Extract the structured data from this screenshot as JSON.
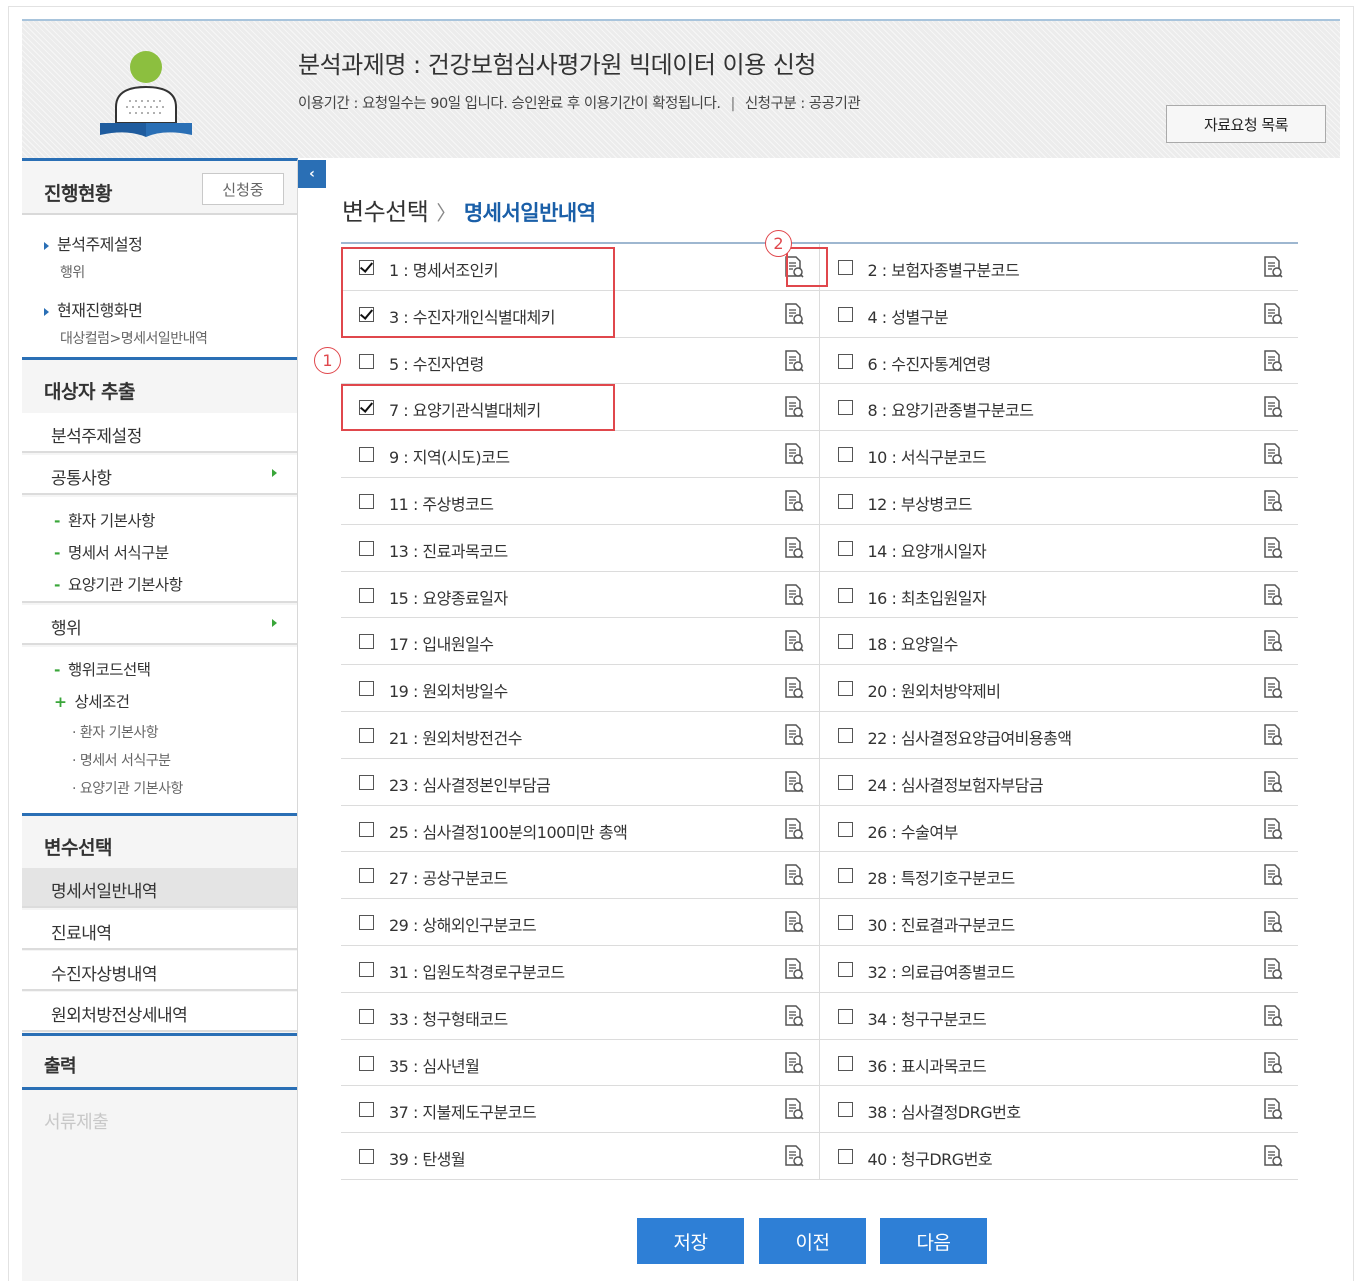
{
  "header": {
    "title": "분석과제명 : 건강보험심사평가원 빅데이터 이용 신청",
    "period_text": "이용기간 : 요청일수는 90일 입니다. 승인완료 후 이용기간이 확정됩니다.",
    "separator": "|",
    "apply_type": "신청구분 : 공공기관",
    "request_list_button": "자료요청 목록"
  },
  "sidebar": {
    "progress_title": "진행현황",
    "status_badge": "신청중",
    "progress_items": [
      {
        "label": "분석주제설정",
        "sub": "행위"
      },
      {
        "label": "현재진행화면",
        "sub": "대상컬럼>명세서일반내역"
      }
    ],
    "extract_title": "대상자 추출",
    "extract_items": [
      "분석주제설정",
      "공통사항"
    ],
    "common_subs": [
      "환자 기본사항",
      "명세서 서식구분",
      "요양기관 기본사항"
    ],
    "action_item": "행위",
    "action_subs": [
      "행위코드선택",
      "상세조건"
    ],
    "detail_subs": [
      "환자 기본사항",
      "명세서 서식구분",
      "요양기관 기본사항"
    ],
    "var_title": "변수선택",
    "var_items": [
      "명세서일반내역",
      "진료내역",
      "수진자상병내역",
      "원외처방전상세내역"
    ],
    "output_title": "출력",
    "submit_title": "서류제출"
  },
  "main": {
    "breadcrumb_root": "변수선택",
    "breadcrumb_current": "명세서일반내역",
    "variables": [
      {
        "label": "1 : 명세서조인키",
        "checked": true
      },
      {
        "label": "2 : 보험자종별구분코드",
        "checked": false
      },
      {
        "label": "3 : 수진자개인식별대체키",
        "checked": true
      },
      {
        "label": "4 : 성별구분",
        "checked": false
      },
      {
        "label": "5 : 수진자연령",
        "checked": false
      },
      {
        "label": "6 : 수진자통계연령",
        "checked": false
      },
      {
        "label": "7 : 요양기관식별대체키",
        "checked": true
      },
      {
        "label": "8 : 요양기관종별구분코드",
        "checked": false
      },
      {
        "label": "9 : 지역(시도)코드",
        "checked": false
      },
      {
        "label": "10 : 서식구분코드",
        "checked": false
      },
      {
        "label": "11 : 주상병코드",
        "checked": false
      },
      {
        "label": "12 : 부상병코드",
        "checked": false
      },
      {
        "label": "13 : 진료과목코드",
        "checked": false
      },
      {
        "label": "14 : 요양개시일자",
        "checked": false
      },
      {
        "label": "15 : 요양종료일자",
        "checked": false
      },
      {
        "label": "16 : 최초입원일자",
        "checked": false
      },
      {
        "label": "17 : 입내원일수",
        "checked": false
      },
      {
        "label": "18 : 요양일수",
        "checked": false
      },
      {
        "label": "19 : 원외처방일수",
        "checked": false
      },
      {
        "label": "20 : 원외처방약제비",
        "checked": false
      },
      {
        "label": "21 : 원외처방전건수",
        "checked": false
      },
      {
        "label": "22 : 심사결정요양급여비용총액",
        "checked": false
      },
      {
        "label": "23 : 심사결정본인부담금",
        "checked": false
      },
      {
        "label": "24 : 심사결정보험자부담금",
        "checked": false
      },
      {
        "label": "25 : 심사결정100분의100미만 총액",
        "checked": false
      },
      {
        "label": "26 : 수술여부",
        "checked": false
      },
      {
        "label": "27 : 공상구분코드",
        "checked": false
      },
      {
        "label": "28 : 특정기호구분코드",
        "checked": false
      },
      {
        "label": "29 : 상해외인구분코드",
        "checked": false
      },
      {
        "label": "30 : 진료결과구분코드",
        "checked": false
      },
      {
        "label": "31 : 입원도착경로구분코드",
        "checked": false
      },
      {
        "label": "32 : 의료급여종별코드",
        "checked": false
      },
      {
        "label": "33 : 청구형태코드",
        "checked": false
      },
      {
        "label": "34 : 청구구분코드",
        "checked": false
      },
      {
        "label": "35 : 심사년월",
        "checked": false
      },
      {
        "label": "36 : 표시과목코드",
        "checked": false
      },
      {
        "label": "37 : 지불제도구분코드",
        "checked": false
      },
      {
        "label": "38 : 심사결정DRG번호",
        "checked": false
      },
      {
        "label": "39 : 탄생월",
        "checked": false
      },
      {
        "label": "40 : 청구DRG번호",
        "checked": false
      }
    ],
    "annotations": [
      "1",
      "2"
    ],
    "buttons": {
      "save": "저장",
      "prev": "이전",
      "next": "다음"
    }
  },
  "colors": {
    "accent": "#2a6fb5",
    "button": "#2e7fd6",
    "highlight": "#e0474c",
    "bullet": "#3aa63a"
  }
}
